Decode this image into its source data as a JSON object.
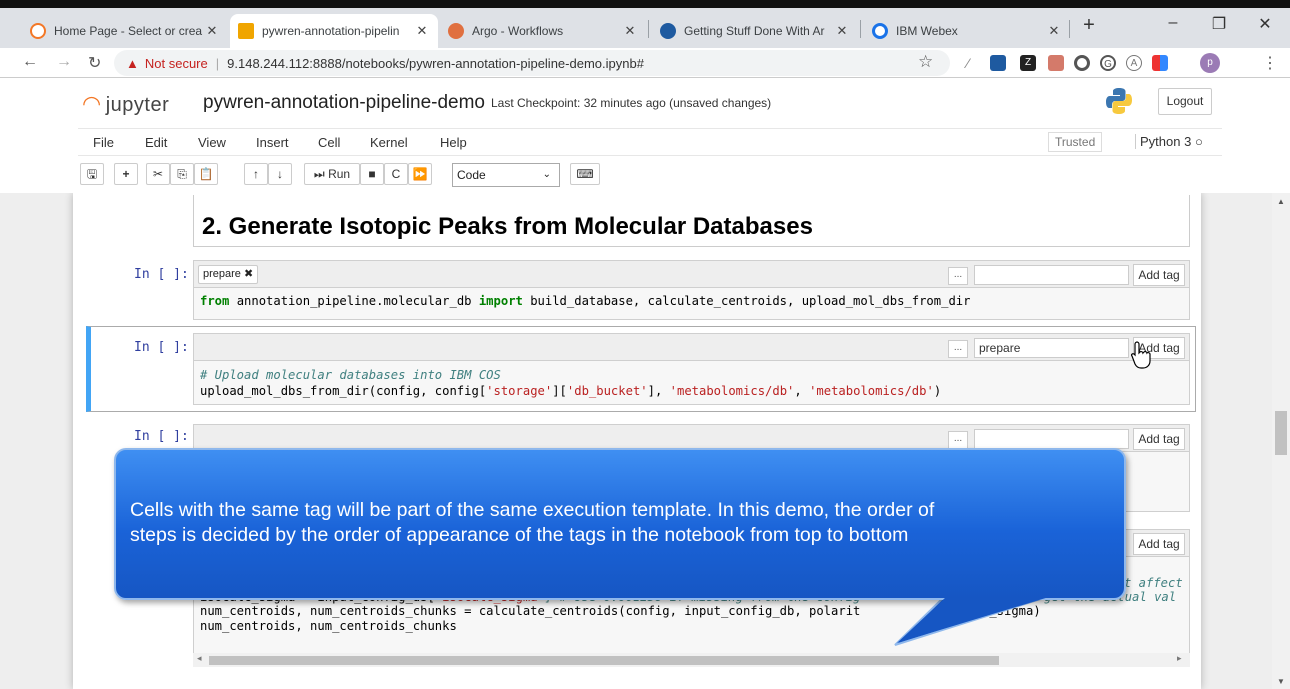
{
  "browser": {
    "tabs": [
      {
        "title": "Home Page - Select or crea",
        "color": "#f37726"
      },
      {
        "title": "pywren-annotation-pipelin",
        "color": "#f0a500"
      },
      {
        "title": "Argo - Workflows",
        "color": "#e07040"
      },
      {
        "title": "Getting Stuff Done With Ar",
        "color": "#1e5aa0"
      },
      {
        "title": "IBM Webex",
        "color": "#1a73e8"
      }
    ],
    "new_tab": "+",
    "not_secure": "Not secure",
    "url": "9.148.244.112:8888/notebooks/pywren-annotation-pipeline-demo.ipynb#",
    "profile_initial": "p"
  },
  "jupyter": {
    "logo_text": "jupyter",
    "notebook_name": "pywren-annotation-pipeline-demo",
    "checkpoint": "Last Checkpoint: 32 minutes ago  (unsaved changes)",
    "logout": "Logout",
    "menu": [
      "File",
      "Edit",
      "View",
      "Insert",
      "Cell",
      "Kernel",
      "Help"
    ],
    "trusted": "Trusted",
    "kernel": "Python 3",
    "run_label": "Run",
    "cell_type": "Code"
  },
  "notebook": {
    "heading": "2. Generate Isotopic Peaks from Molecular Databases",
    "prompt": "In [ ]:",
    "add_tag": "Add tag",
    "dots": "...",
    "cell1": {
      "tag": "prepare ✖",
      "code": {
        "from": "from",
        "module": " annotation_pipeline.molecular_db ",
        "import": "import",
        "rest": " build_database, calculate_centroids, upload_mol_dbs_from_dir"
      }
    },
    "cell2": {
      "tag_input": "prepare",
      "comment": "# Upload molecular databases into IBM COS",
      "line2_a": "upload_mol_dbs_from_dir(config, config[",
      "s1": "'storage'",
      "mid1": "][",
      "s2": "'db_bucket'",
      "mid2": "], ",
      "s3": "'metabolomics/db'",
      "mid3": ", ",
      "s4": "'metabolomics/db'",
      "end": ")"
    },
    "cell4": {
      "partial1": "t affect",
      "partial2a": "isocalc_sigma = input_config_ds[",
      "partial2b": "'isocalc_sigma'",
      "partial2c": "] # Use 0.001238 if missing from the config",
      "partial2d": "to get the actual val",
      "line3": "num_centroids, num_centroids_chunks = calculate_centroids(config, input_config_db, polarit",
      "line3b": "c_sigma)",
      "line4": "num_centroids, num_centroids_chunks"
    },
    "callout": "Cells with the same tag will be part of the same execution template. In this demo, the order of\n  steps is decided by the order of appearance of the tags in the notebook from top to bottom"
  }
}
